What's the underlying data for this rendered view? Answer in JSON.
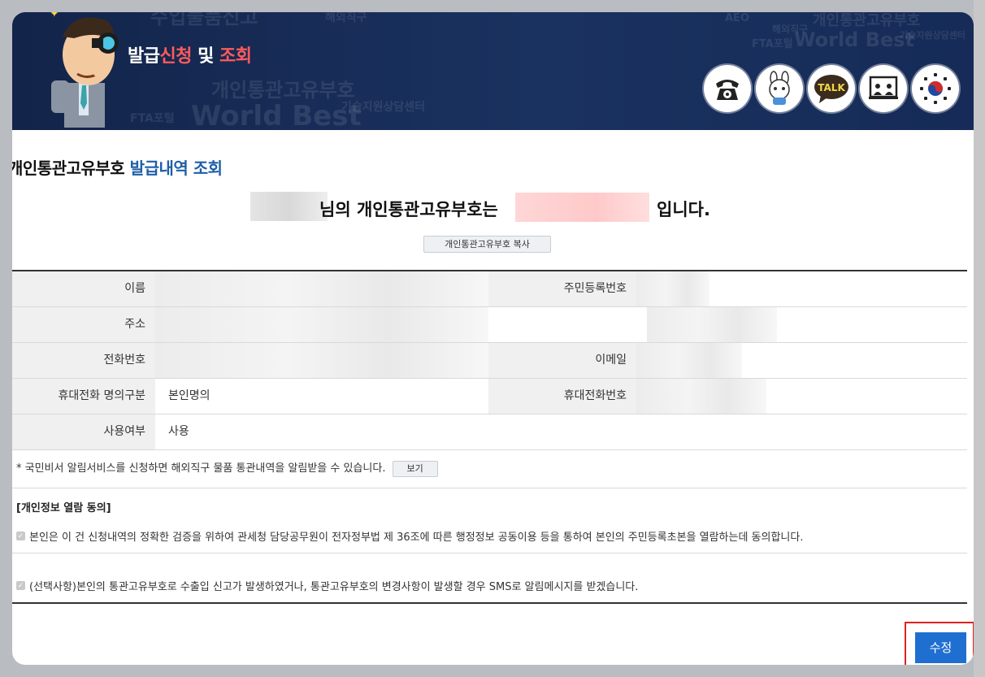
{
  "header": {
    "title_part1": "발급",
    "title_part2": "신청",
    "title_part3": " 및 ",
    "title_part4": "조회",
    "bg_words": [
      "수입물품신고",
      "해외직구",
      "개인통관고유부호",
      "World Best",
      "FTA포털",
      "기술지원상담센터",
      "AEO",
      "해외직구",
      "개인통관고유부호",
      "World Best",
      "기술지원상담센터",
      "FTA포털"
    ],
    "icons": [
      "phone-icon",
      "mascot-icon",
      "talk-icon",
      "video-consult-icon",
      "taegeuk-icon"
    ],
    "talk_label": "TALK"
  },
  "page_title": {
    "main": "개인통관고유부호",
    "accent": " 발급내역 조회"
  },
  "result": {
    "mid": "님의 개인통관고유부호는",
    "end": "입니다."
  },
  "copy_button": "개인통관고유부호 복사",
  "table": {
    "name_label": "이름",
    "rrn_label": "주민등록번호",
    "address_label": "주소",
    "phone_label": "전화번호",
    "email_label": "이메일",
    "mobile_type_label": "휴대전화 명의구분",
    "mobile_type_value": "본인명의",
    "mobile_label": "휴대전화번호",
    "use_label": "사용여부",
    "use_value": "사용"
  },
  "notice": {
    "text": "* 국민비서 알림서비스를 신청하면 해외직구 물품 통관내역을 알림받을 수 있습니다.",
    "button": "보기"
  },
  "consent": {
    "title": "[개인정보 열람 동의]",
    "item1": "본인은 이 건 신청내역의 정확한 검증을 위하여 관세청 담당공무원이 전자정부법 제 36조에 따른 행정정보 공동이용 등을 통하여 본인의 주민등록초본을 열람하는데 동의합니다.",
    "item2": "(선택사항)본인의 통관고유부호로 수출입 신고가 발생하였거나, 통관고유부호의 변경사항이 발생할 경우 SMS로 알림메시지를 받겠습니다."
  },
  "edit_button": "수정",
  "colors": {
    "header_bg": "#13244a",
    "accent_blue": "#1f5fa8",
    "accent_red": "#ff5b5b",
    "button_blue": "#1f6fd0",
    "highlight_red": "#e02020"
  }
}
